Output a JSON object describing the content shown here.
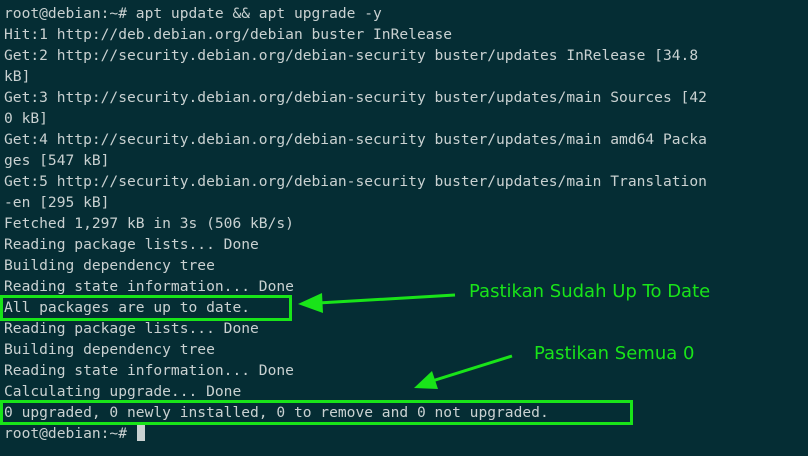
{
  "terminal": {
    "lines": [
      "root@debian:~# apt update && apt upgrade -y",
      "Hit:1 http://deb.debian.org/debian buster InRelease",
      "Get:2 http://security.debian.org/debian-security buster/updates InRelease [34.8",
      "kB]",
      "Get:3 http://security.debian.org/debian-security buster/updates/main Sources [42",
      "0 kB]",
      "Get:4 http://security.debian.org/debian-security buster/updates/main amd64 Packa",
      "ges [547 kB]",
      "Get:5 http://security.debian.org/debian-security buster/updates/main Translation",
      "-en [295 kB]",
      "Fetched 1,297 kB in 3s (506 kB/s)",
      "Reading package lists... Done",
      "Building dependency tree",
      "Reading state information... Done",
      "All packages are up to date.",
      "Reading package lists... Done",
      "Building dependency tree",
      "Reading state information... Done",
      "Calculating upgrade... Done",
      "0 upgraded, 0 newly installed, 0 to remove and 0 not upgraded."
    ],
    "prompt": "root@debian:~# "
  },
  "annotations": {
    "up_to_date": "Pastikan Sudah Up To Date",
    "all_zero": "Pastikan Semua 0"
  },
  "colors": {
    "background": "#052d34",
    "text": "#c9d1d1",
    "highlight": "#19e419"
  }
}
